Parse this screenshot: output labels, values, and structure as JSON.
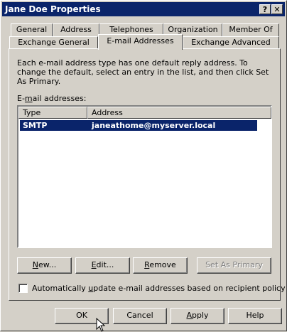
{
  "window": {
    "title": "Jane Doe Properties",
    "help_glyph": "?",
    "close_glyph": "✕"
  },
  "tabs_back": [
    {
      "label": "General"
    },
    {
      "label": "Address"
    },
    {
      "label": "Telephones"
    },
    {
      "label": "Organization"
    },
    {
      "label": "Member Of"
    }
  ],
  "tabs_front": [
    {
      "label": "Exchange General"
    },
    {
      "label": "E-mail Addresses",
      "active": true
    },
    {
      "label": "Exchange Advanced"
    }
  ],
  "description": "Each e-mail address type has one default reply address. To change the default, select an entry in the list, and then click Set As Primary.",
  "list_label": {
    "pre": "E-",
    "mnemonic": "m",
    "post": "ail addresses:"
  },
  "columns": [
    "Type",
    "Address"
  ],
  "rows": [
    {
      "type": "SMTP",
      "address": "janeathome@myserver.local"
    }
  ],
  "buttons": {
    "new": {
      "mnemonic": "N",
      "rest": "ew..."
    },
    "edit": {
      "mnemonic": "E",
      "rest": "dit..."
    },
    "remove": {
      "mnemonic": "R",
      "rest": "emove"
    },
    "set_primary": {
      "label": "Set As Primary",
      "enabled": false
    }
  },
  "checkbox": {
    "pre": "Automatically ",
    "mnemonic": "u",
    "post": "pdate e-mail addresses based on recipient policy",
    "checked": false
  },
  "dialog_buttons": {
    "ok": "OK",
    "cancel": "Cancel",
    "apply": {
      "mnemonic": "A",
      "rest": "pply"
    },
    "help": "Help"
  },
  "colors": {
    "face": "#d4d0c8",
    "title_bar": "#0a246a",
    "selection": "#0a246a"
  }
}
